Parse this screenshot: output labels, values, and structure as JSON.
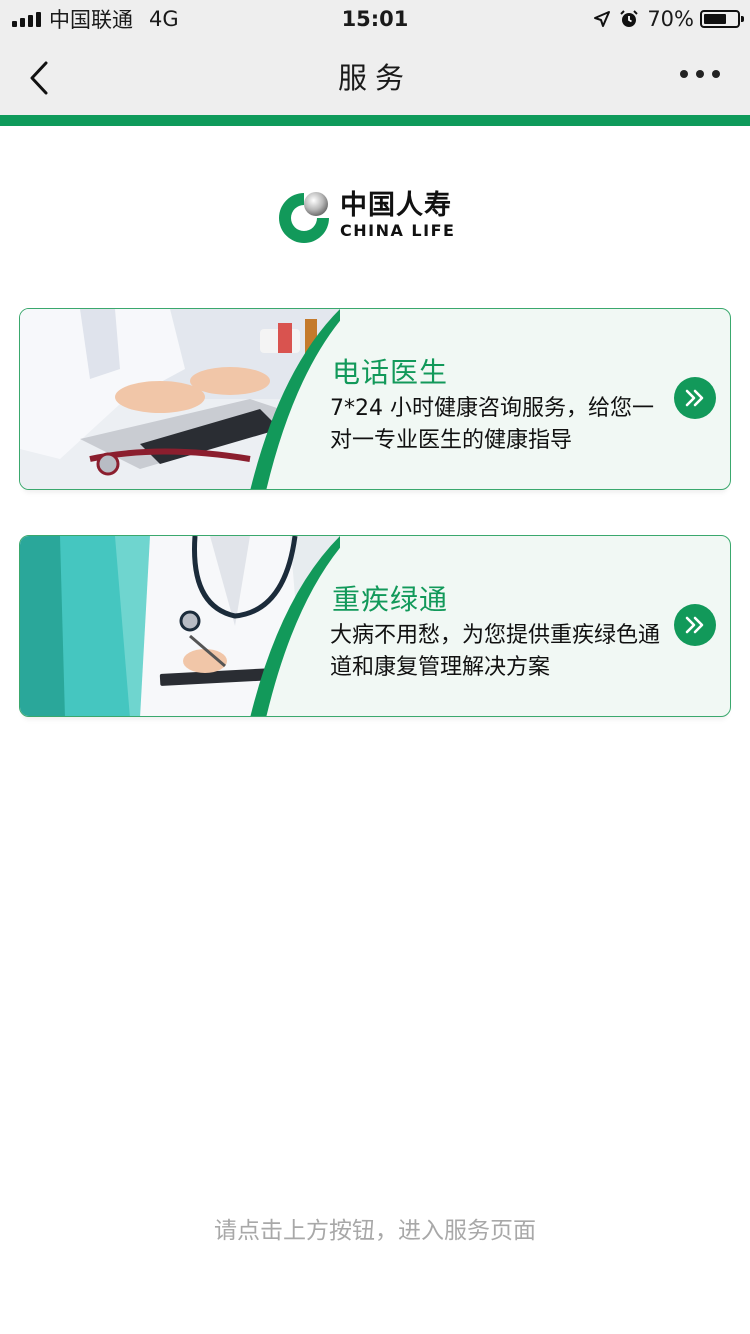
{
  "status_bar": {
    "carrier": "中国联通",
    "network": "4G",
    "time": "15:01",
    "battery_text": "70%",
    "battery_level": 0.7
  },
  "nav": {
    "title": "服务",
    "back_icon": "chevron-left-icon",
    "more_icon": "more-dots-icon"
  },
  "brand": {
    "name_cn": "中国人寿",
    "name_en": "CHINA LIFE",
    "logo_icon": "china-life-logo",
    "accent_color": "#12995a"
  },
  "services": [
    {
      "title": "电话医生",
      "description": "7*24 小时健康咨询服务，给您一对一专业医生的健康指导",
      "image_icon": "doctor-typing-laptop-image",
      "arrow_icon": "double-chevron-right-icon"
    },
    {
      "title": "重疾绿通",
      "description": "大病不用愁，为您提供重疾绿色通道和康复管理解决方案",
      "image_icon": "medical-staff-clipboard-image",
      "arrow_icon": "double-chevron-right-icon"
    }
  ],
  "footer": {
    "hint": "请点击上方按钮，进入服务页面"
  }
}
